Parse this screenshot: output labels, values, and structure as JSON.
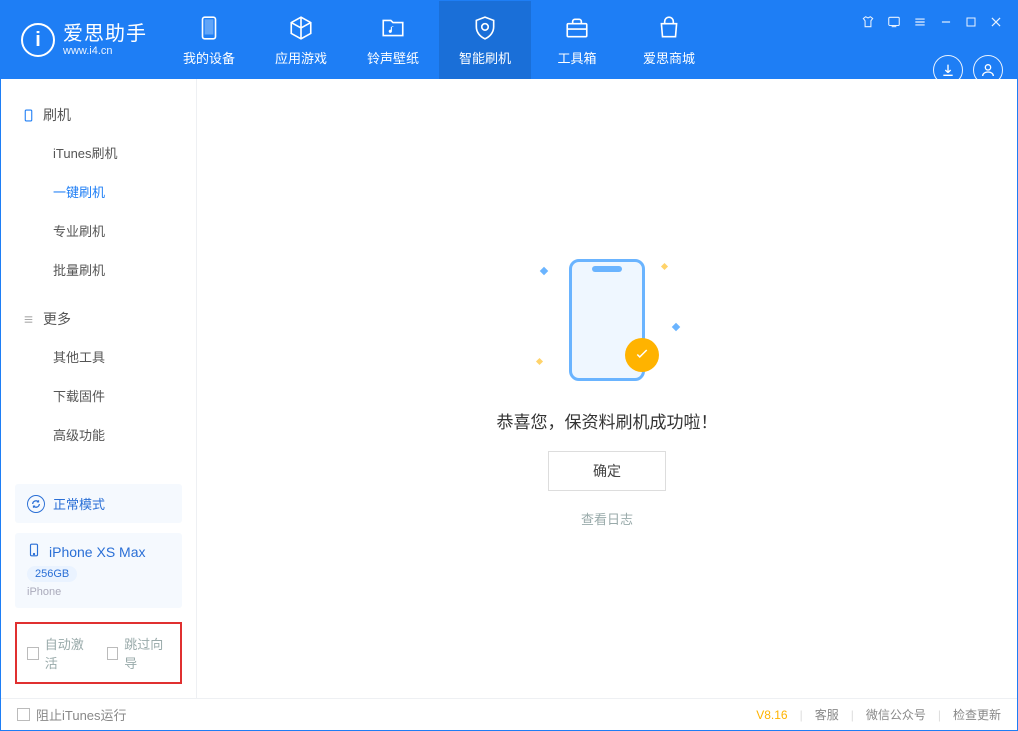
{
  "app": {
    "logo_char": "i",
    "logo_title": "爱思助手",
    "logo_sub": "www.i4.cn"
  },
  "nav": [
    {
      "label": "我的设备"
    },
    {
      "label": "应用游戏"
    },
    {
      "label": "铃声壁纸"
    },
    {
      "label": "智能刷机"
    },
    {
      "label": "工具箱"
    },
    {
      "label": "爱思商城"
    }
  ],
  "sidebar": {
    "section1_title": "刷机",
    "items1": [
      {
        "label": "iTunes刷机"
      },
      {
        "label": "一键刷机"
      },
      {
        "label": "专业刷机"
      },
      {
        "label": "批量刷机"
      }
    ],
    "section2_title": "更多",
    "items2": [
      {
        "label": "其他工具"
      },
      {
        "label": "下载固件"
      },
      {
        "label": "高级功能"
      }
    ]
  },
  "device_mode": "正常模式",
  "device": {
    "name": "iPhone XS Max",
    "storage": "256GB",
    "type": "iPhone"
  },
  "options": {
    "auto_activate": "自动激活",
    "skip_guide": "跳过向导"
  },
  "main": {
    "success_text": "恭喜您，保资料刷机成功啦！",
    "ok_button": "确定",
    "view_log": "查看日志"
  },
  "footer": {
    "block_itunes": "阻止iTunes运行",
    "version": "V8.16",
    "support": "客服",
    "wechat": "微信公众号",
    "check_update": "检查更新"
  }
}
